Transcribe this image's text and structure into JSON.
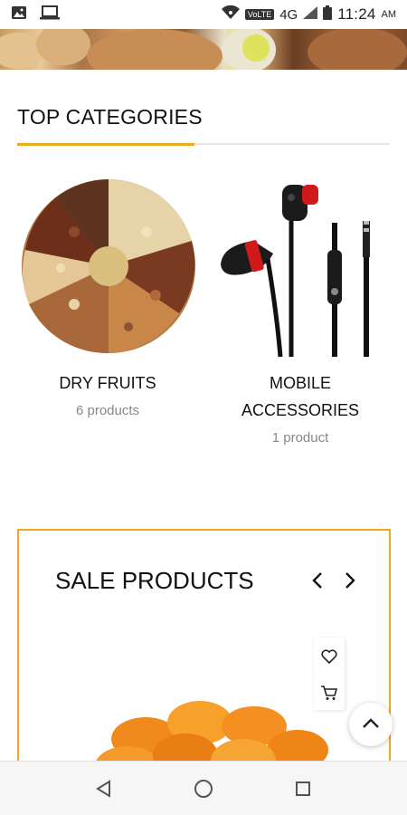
{
  "status_bar": {
    "network_label": "VoLTE",
    "network_type": "4G",
    "time": "11:24",
    "ampm": "AM"
  },
  "top_categories": {
    "title": "TOP CATEGORIES",
    "accent_color": "#f0a81c",
    "items": [
      {
        "name": "DRY FRUITS",
        "count": "6 products",
        "image": "dry-fruits"
      },
      {
        "name_line1": "MOBILE",
        "name_line2": "ACCESSORIES",
        "count": "1 product",
        "image": "earphones"
      }
    ]
  },
  "sale_products": {
    "title": "SALE PRODUCTS",
    "prev_icon": "chevron-left-icon",
    "next_icon": "chevron-right-icon",
    "wishlist_icon": "heart-icon",
    "cart_icon": "cart-icon",
    "product_image": "dried-apricots"
  },
  "scroll_top_icon": "chevron-up-icon",
  "nav": {
    "back_icon": "back-triangle-icon",
    "home_icon": "home-circle-icon",
    "recents_icon": "recents-square-icon"
  }
}
